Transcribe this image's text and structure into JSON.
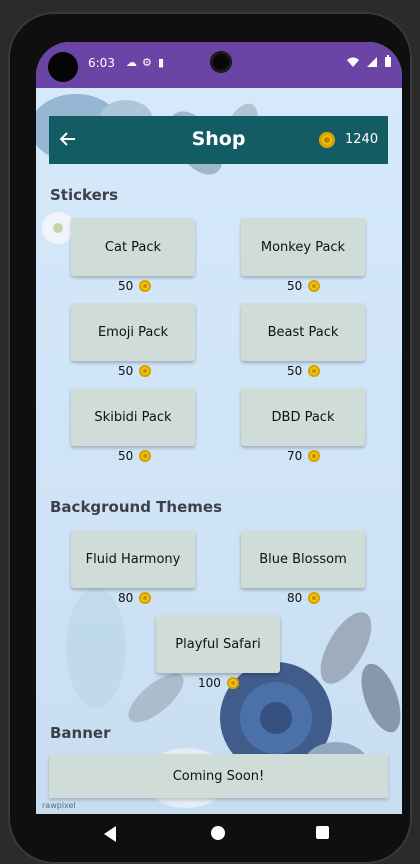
{
  "status": {
    "time": "6:03"
  },
  "header": {
    "title": "Shop",
    "coin_count": "1240"
  },
  "sections": {
    "stickers": "Stickers",
    "backgrounds": "Background Themes",
    "banner": "Banner"
  },
  "stickers": [
    {
      "name": "Cat Pack",
      "price": "50"
    },
    {
      "name": "Monkey Pack",
      "price": "50"
    },
    {
      "name": "Emoji Pack",
      "price": "50"
    },
    {
      "name": "Beast Pack",
      "price": "50"
    },
    {
      "name": "Skibidi Pack",
      "price": "50"
    },
    {
      "name": "DBD Pack",
      "price": "70"
    }
  ],
  "themes": [
    {
      "name": "Fluid Harmony",
      "price": "80"
    },
    {
      "name": "Blue Blossom",
      "price": "80"
    },
    {
      "name": "Playful Safari",
      "price": "100"
    }
  ],
  "banner": {
    "label": "Coming Soon!"
  },
  "watermark": "rawpixel",
  "colors": {
    "appbar": "#145c63",
    "statusbar": "#6b45a6",
    "card": "#cfdcd8",
    "coin": "#f1c40f"
  }
}
